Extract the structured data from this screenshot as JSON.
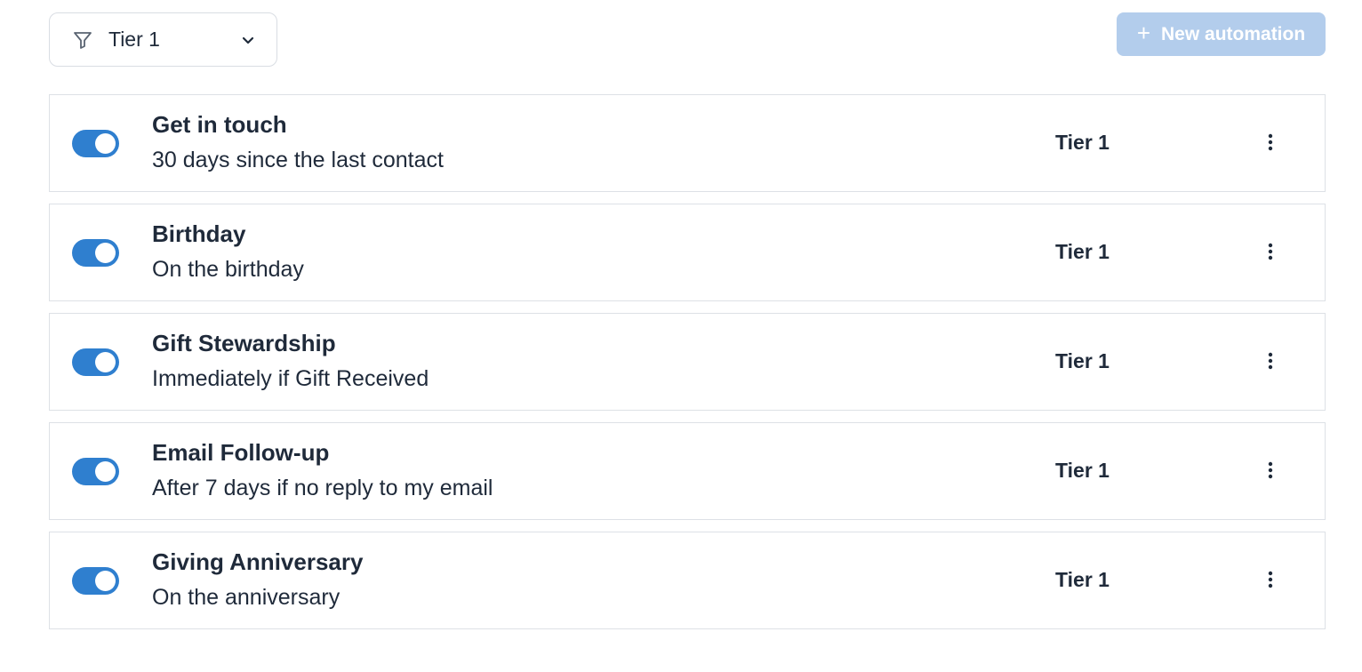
{
  "filter": {
    "icon": "filter-icon",
    "selected": "Tier 1",
    "dropdown_icon": "chevron-down-icon"
  },
  "new_automation": {
    "icon": "plus-icon",
    "label": "New automation",
    "color": "#b3cdec"
  },
  "toggle_color": "#2f7fcf",
  "automations": [
    {
      "title": "Get in touch",
      "subtitle": "30 days since the last contact",
      "tier": "Tier 1",
      "enabled": true
    },
    {
      "title": "Birthday",
      "subtitle": "On the birthday",
      "tier": "Tier 1",
      "enabled": true
    },
    {
      "title": "Gift Stewardship",
      "subtitle": "Immediately if Gift Received",
      "tier": "Tier 1",
      "enabled": true
    },
    {
      "title": "Email Follow-up",
      "subtitle": "After 7 days if no reply to my email",
      "tier": "Tier 1",
      "enabled": true
    },
    {
      "title": "Giving Anniversary",
      "subtitle": "On the anniversary",
      "tier": "Tier 1",
      "enabled": true
    }
  ]
}
